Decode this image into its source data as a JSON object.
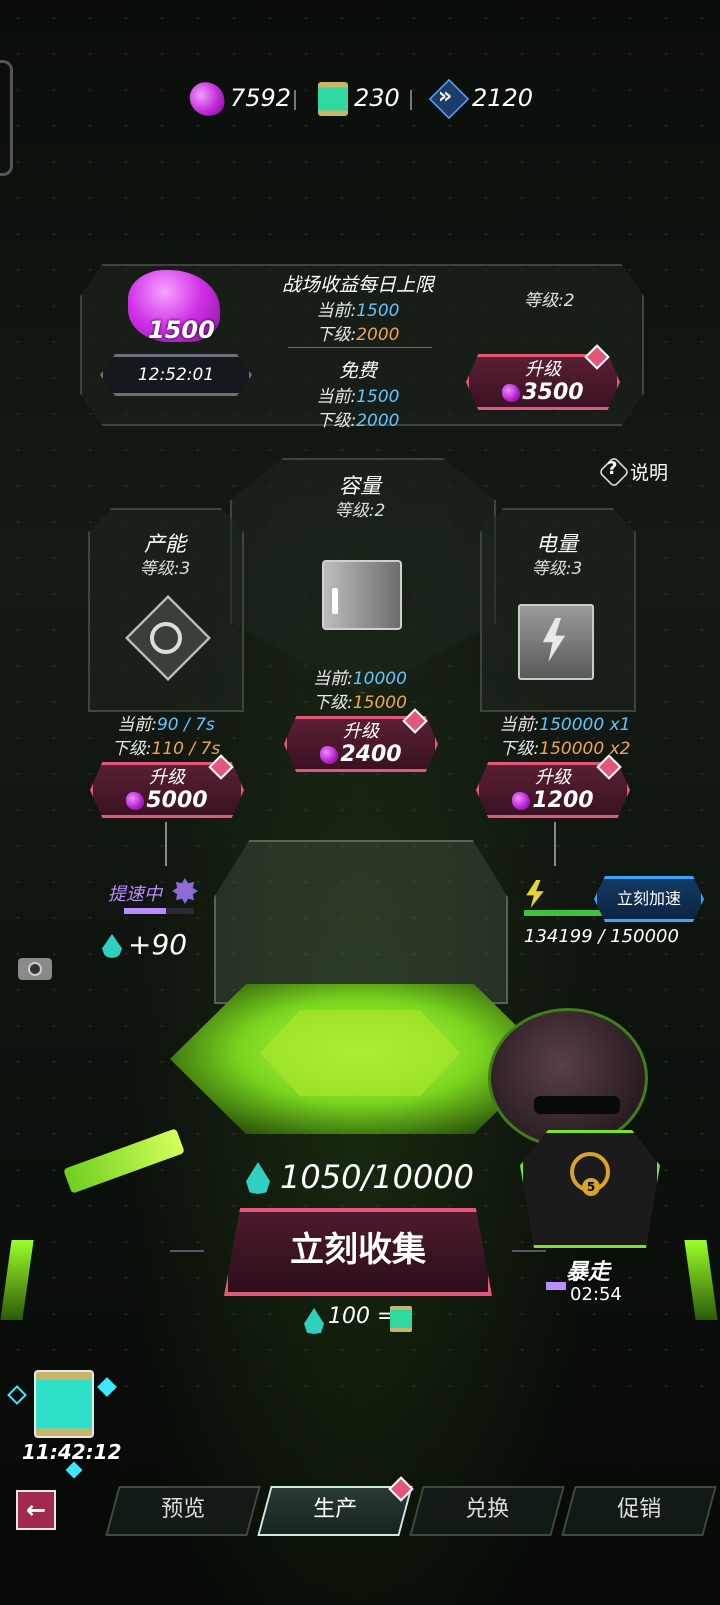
{
  "currencies": {
    "gems": "7592",
    "scrolls": "230",
    "chevrons": "2120"
  },
  "battlefield": {
    "title": "战场收益每日上限",
    "current_label": "当前:",
    "current_value": "1500",
    "next_label": "下级:",
    "next_value": "2000",
    "stored_amount": "1500",
    "timer": "12:52:01",
    "level": "等级:2",
    "upgrade_label": "升级",
    "upgrade_cost": "3500"
  },
  "free": {
    "title": "免费",
    "current_label": "当前:",
    "current_value": "1500",
    "next_label": "下级:",
    "next_value": "2000"
  },
  "help": {
    "label": "说明"
  },
  "capacity": {
    "title": "容量",
    "level": "等级:2",
    "current_label": "当前:",
    "current_value": "10000",
    "next_label": "下级:",
    "next_value": "15000",
    "upgrade_label": "升级",
    "upgrade_cost": "2400"
  },
  "production": {
    "title": "产能",
    "level": "等级:3",
    "current_label": "当前:",
    "current_value": "90 / 7s",
    "next_label": "下级:",
    "next_value": "110 / 7s",
    "upgrade_label": "升级",
    "upgrade_cost": "5000",
    "boost_label": "提速中",
    "boost_progress": 0.6,
    "gain": "+90"
  },
  "power": {
    "title": "电量",
    "level": "等级:3",
    "current_label": "当前:",
    "current_value": "150000 x1",
    "next_label": "下级:",
    "next_value": "150000 x2",
    "upgrade_label": "升级",
    "upgrade_cost": "1200",
    "accelerate_label": "立刻加速",
    "amount": "134199 / 150000",
    "progress": 0.89
  },
  "collector": {
    "amount": "1050/10000",
    "collect_label": "立刻收集",
    "rate": "100 ="
  },
  "character": {
    "status": "暴走",
    "timer": "02:54",
    "badge": "5"
  },
  "bonus": {
    "timer": "11:42:12"
  },
  "tabs": [
    {
      "label": "预览"
    },
    {
      "label": "生产"
    },
    {
      "label": "兑换"
    },
    {
      "label": "促销"
    }
  ],
  "colors": {
    "accent_green": "#8dff2a",
    "pink": "#e4567a",
    "blue": "#5fc6ff",
    "orange": "#f0a64a"
  }
}
